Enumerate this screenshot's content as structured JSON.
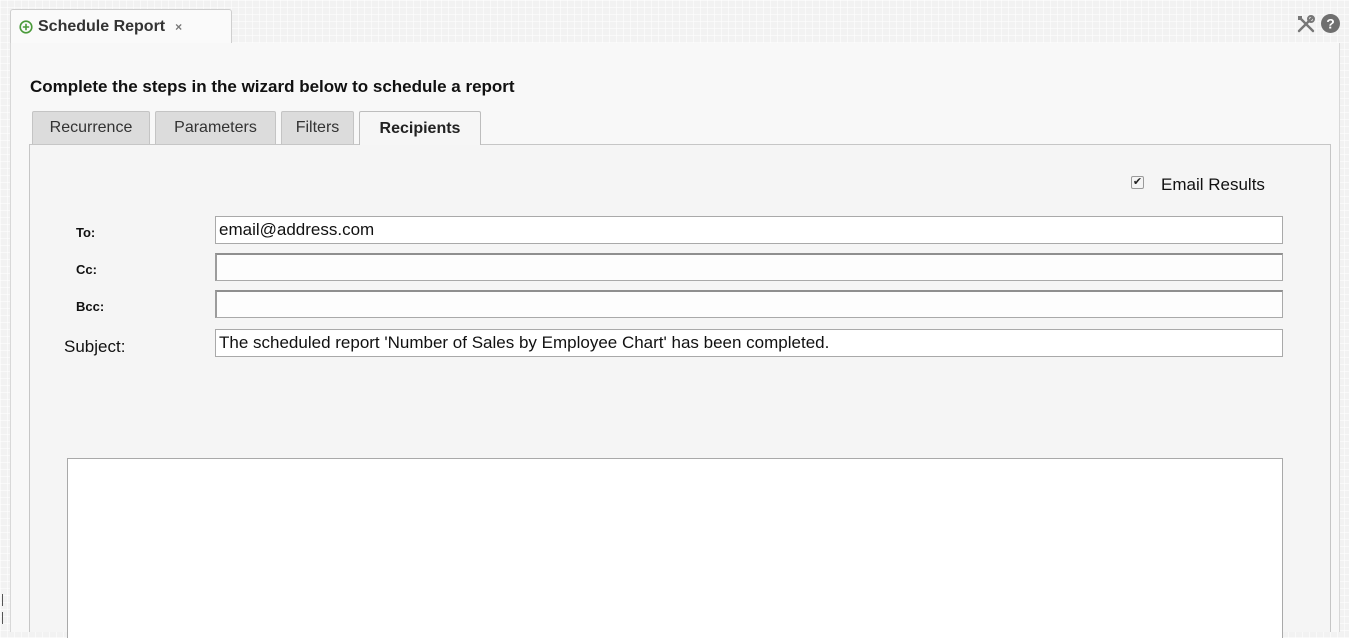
{
  "window": {
    "tab_title": "Schedule Report",
    "tab_close": "×",
    "icons": {
      "tab": "schedule-plus-icon",
      "tools": "tools-icon",
      "help": "help-icon"
    },
    "help_glyph": "?"
  },
  "wizard": {
    "heading": "Complete the steps in the wizard below to schedule a report",
    "tabs": [
      {
        "label": "Recurrence",
        "active": false
      },
      {
        "label": "Parameters",
        "active": false
      },
      {
        "label": "Filters",
        "active": false
      },
      {
        "label": "Recipients",
        "active": true
      }
    ]
  },
  "recipients": {
    "email_results": {
      "label": "Email Results",
      "checked": true
    },
    "to": {
      "label": "To:",
      "value": "email@address.com"
    },
    "cc": {
      "label": "Cc:",
      "value": ""
    },
    "bcc": {
      "label": "Bcc:",
      "value": ""
    },
    "subject": {
      "label": "Subject:",
      "value": "The scheduled report 'Number of Sales by Employee Chart' has been completed."
    },
    "body": ""
  },
  "colors": {
    "background": "#f2f2f2",
    "panel": "#f8f8f8",
    "tab_inactive": "#dcdcdc",
    "tab_active": "#f6f6f6",
    "icon_green": "#4a9a3a",
    "icon_gray": "#777777"
  }
}
